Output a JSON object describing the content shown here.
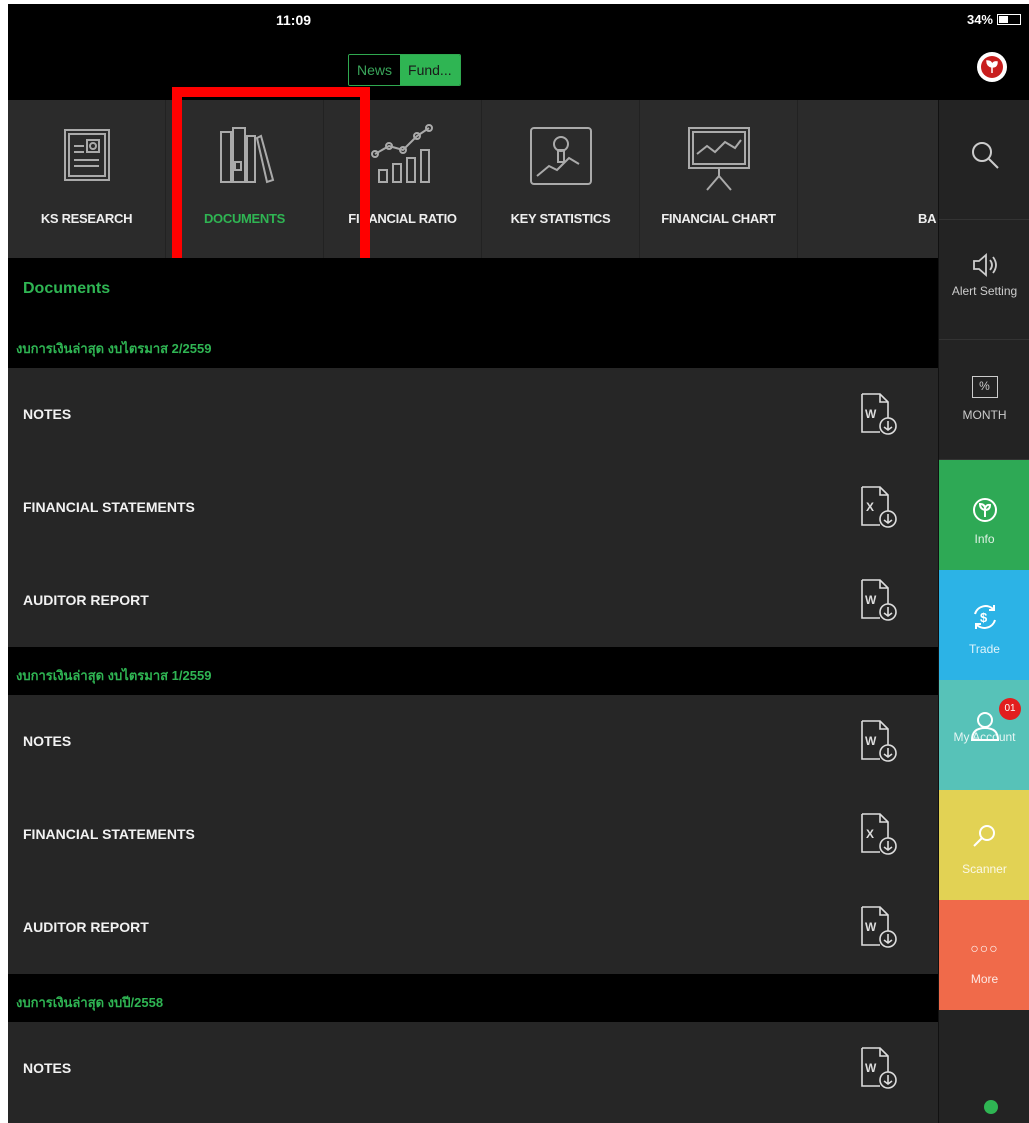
{
  "status_bar": {
    "time": "11:09",
    "battery": "34%"
  },
  "top_segment": {
    "news_label": "News",
    "fund_label": "Fund..."
  },
  "menu_tabs": [
    {
      "label": "KS RESEARCH",
      "icon": "research-report-icon"
    },
    {
      "label": "DOCUMENTS",
      "icon": "documents-binders-icon",
      "active": true
    },
    {
      "label": "FINANCIAL RATIO",
      "icon": "ratio-chart-icon"
    },
    {
      "label": "KEY STATISTICS",
      "icon": "key-statistics-icon"
    },
    {
      "label": "FINANCIAL CHART",
      "icon": "presentation-chart-icon"
    },
    {
      "label": "BA",
      "icon": ""
    }
  ],
  "documents": {
    "title": "Documents",
    "sections": [
      {
        "header": "งบการเงินล่าสุด งบไตรมาส 2/2559",
        "items": [
          {
            "name": "NOTES",
            "file_type": "W"
          },
          {
            "name": "FINANCIAL STATEMENTS",
            "file_type": "X"
          },
          {
            "name": "AUDITOR REPORT",
            "file_type": "W"
          }
        ]
      },
      {
        "header": "งบการเงินล่าสุด งบไตรมาส 1/2559",
        "items": [
          {
            "name": "NOTES",
            "file_type": "W"
          },
          {
            "name": "FINANCIAL STATEMENTS",
            "file_type": "X"
          },
          {
            "name": "AUDITOR REPORT",
            "file_type": "W"
          }
        ]
      },
      {
        "header": "งบการเงินล่าสุด งบปี/2558",
        "items": [
          {
            "name": "NOTES",
            "file_type": "W"
          }
        ]
      }
    ]
  },
  "sidebar": {
    "alert_label": "Alert Setting",
    "month_label": "MONTH",
    "month_badge": "%",
    "info_label": "Info",
    "trade_label": "Trade",
    "account_label": "My Account",
    "account_badge": "01",
    "scanner_label": "Scanner",
    "more_label": "More"
  },
  "colors": {
    "accent_green": "#2fb553",
    "info": "#2ea955",
    "trade": "#2cb3e6",
    "account": "#57c2b8",
    "scanner": "#e2d254",
    "more": "#f06a4a",
    "highlight": "#ff0000"
  }
}
